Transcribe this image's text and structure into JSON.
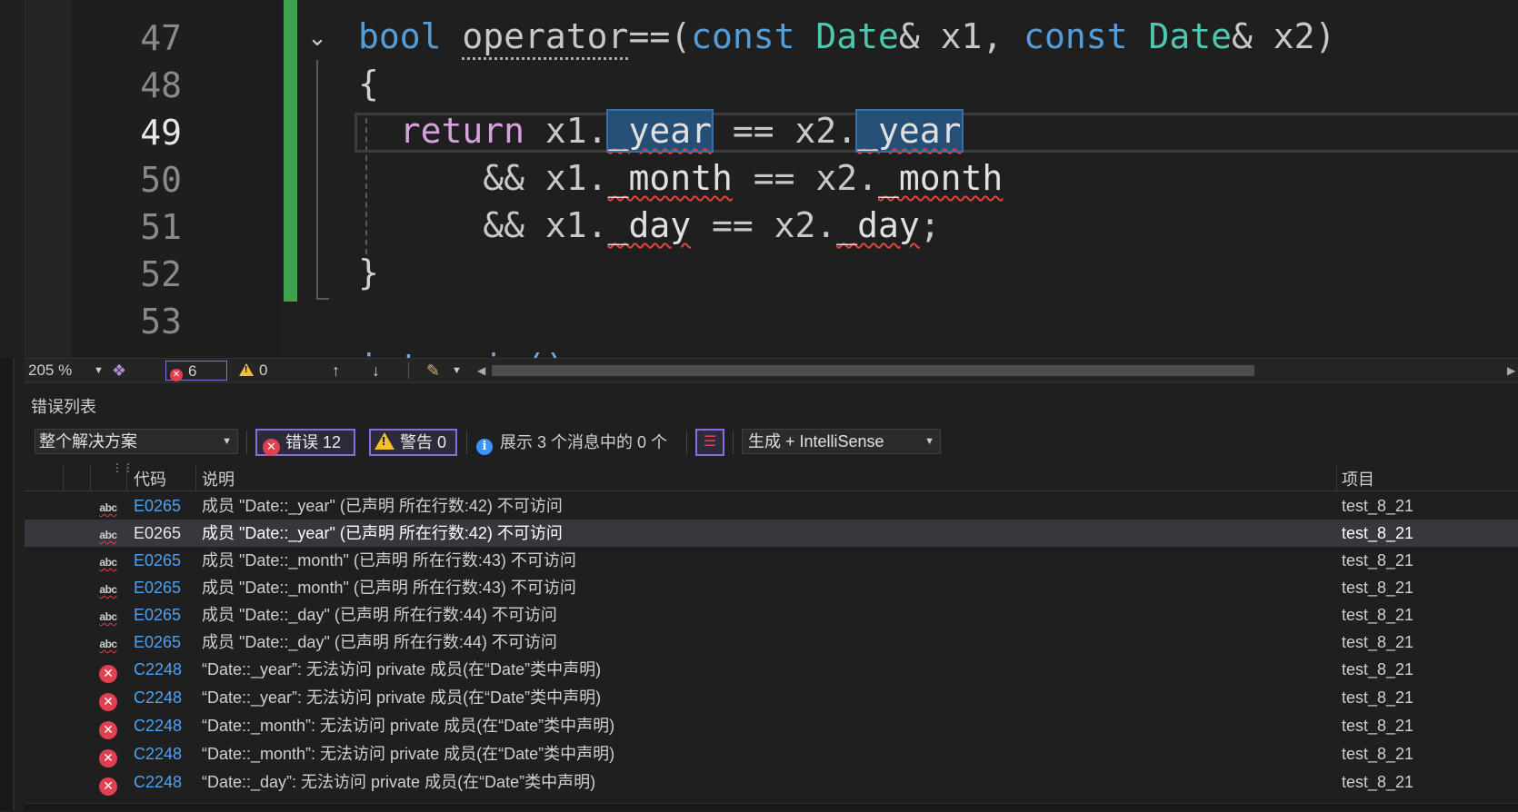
{
  "editor": {
    "line_numbers": [
      "47",
      "48",
      "49",
      "50",
      "51",
      "52",
      "53"
    ],
    "active_line": "49",
    "code": {
      "l47": {
        "kw_bool": "bool",
        "fn": "operator",
        "rest": "==(",
        "kw_const1": "const",
        "type1": "Date",
        "amp1": "& x1, ",
        "kw_const2": "const",
        "type2": "Date",
        "amp2": "& x2)"
      },
      "l48": "{",
      "l49": {
        "kw_return": "return",
        "pre": " x1.",
        "f1": "_year",
        "mid": " == x2.",
        "f2": "_year"
      },
      "l50": {
        "pre": "&& x1.",
        "f1": "_month",
        "mid": " == x2.",
        "f2": "_month"
      },
      "l51": {
        "pre": "&& x1.",
        "f1": "_day",
        "mid": " == x2.",
        "f2": "_day",
        "end": ";"
      },
      "l52": "}",
      "l53_partial": "int main()"
    }
  },
  "status": {
    "zoom": "205 %",
    "error_count": "6",
    "warning_count": "0",
    "icons": {
      "hint": "intellicode-icon",
      "nav_up": "arrow-up-icon",
      "nav_down": "arrow-down-icon",
      "cleanup": "brush-icon"
    }
  },
  "error_list": {
    "title": "错误列表",
    "scope": "整个解决方案",
    "errors_btn": "错误 12",
    "warnings_btn": "警告 0",
    "messages_info": "展示 3 个消息中的 0 个",
    "build_filter": "生成 + IntelliSense",
    "columns": {
      "code": "代码",
      "description": "说明",
      "project": "项目"
    },
    "rows": [
      {
        "icon": "abc",
        "code": "E0265",
        "description": "成员 \"Date::_year\" (已声明 所在行数:42) 不可访问",
        "project": "test_8_21",
        "selected": false
      },
      {
        "icon": "abc",
        "code": "E0265",
        "description": "成员 \"Date::_year\" (已声明 所在行数:42) 不可访问",
        "project": "test_8_21",
        "selected": true
      },
      {
        "icon": "abc",
        "code": "E0265",
        "description": "成员 \"Date::_month\" (已声明 所在行数:43) 不可访问",
        "project": "test_8_21",
        "selected": false
      },
      {
        "icon": "abc",
        "code": "E0265",
        "description": "成员 \"Date::_month\" (已声明 所在行数:43) 不可访问",
        "project": "test_8_21",
        "selected": false
      },
      {
        "icon": "abc",
        "code": "E0265",
        "description": "成员 \"Date::_day\" (已声明 所在行数:44) 不可访问",
        "project": "test_8_21",
        "selected": false
      },
      {
        "icon": "abc",
        "code": "E0265",
        "description": "成员 \"Date::_day\" (已声明 所在行数:44) 不可访问",
        "project": "test_8_21",
        "selected": false
      },
      {
        "icon": "error",
        "code": "C2248",
        "description": "“Date::_year”: 无法访问 private 成员(在“Date”类中声明)",
        "project": "test_8_21",
        "selected": false
      },
      {
        "icon": "error",
        "code": "C2248",
        "description": "“Date::_year”: 无法访问 private 成员(在“Date”类中声明)",
        "project": "test_8_21",
        "selected": false
      },
      {
        "icon": "error",
        "code": "C2248",
        "description": "“Date::_month”: 无法访问 private 成员(在“Date”类中声明)",
        "project": "test_8_21",
        "selected": false
      },
      {
        "icon": "error",
        "code": "C2248",
        "description": "“Date::_month”: 无法访问 private 成员(在“Date”类中声明)",
        "project": "test_8_21",
        "selected": false
      },
      {
        "icon": "error",
        "code": "C2248",
        "description": "“Date::_day”: 无法访问 private 成员(在“Date”类中声明)",
        "project": "test_8_21",
        "selected": false
      }
    ]
  },
  "colors": {
    "accent": "#8a6ce0",
    "error": "#e04050",
    "warning": "#f0c030",
    "change_bar": "#3fa34d",
    "link": "#4ea1f2"
  }
}
